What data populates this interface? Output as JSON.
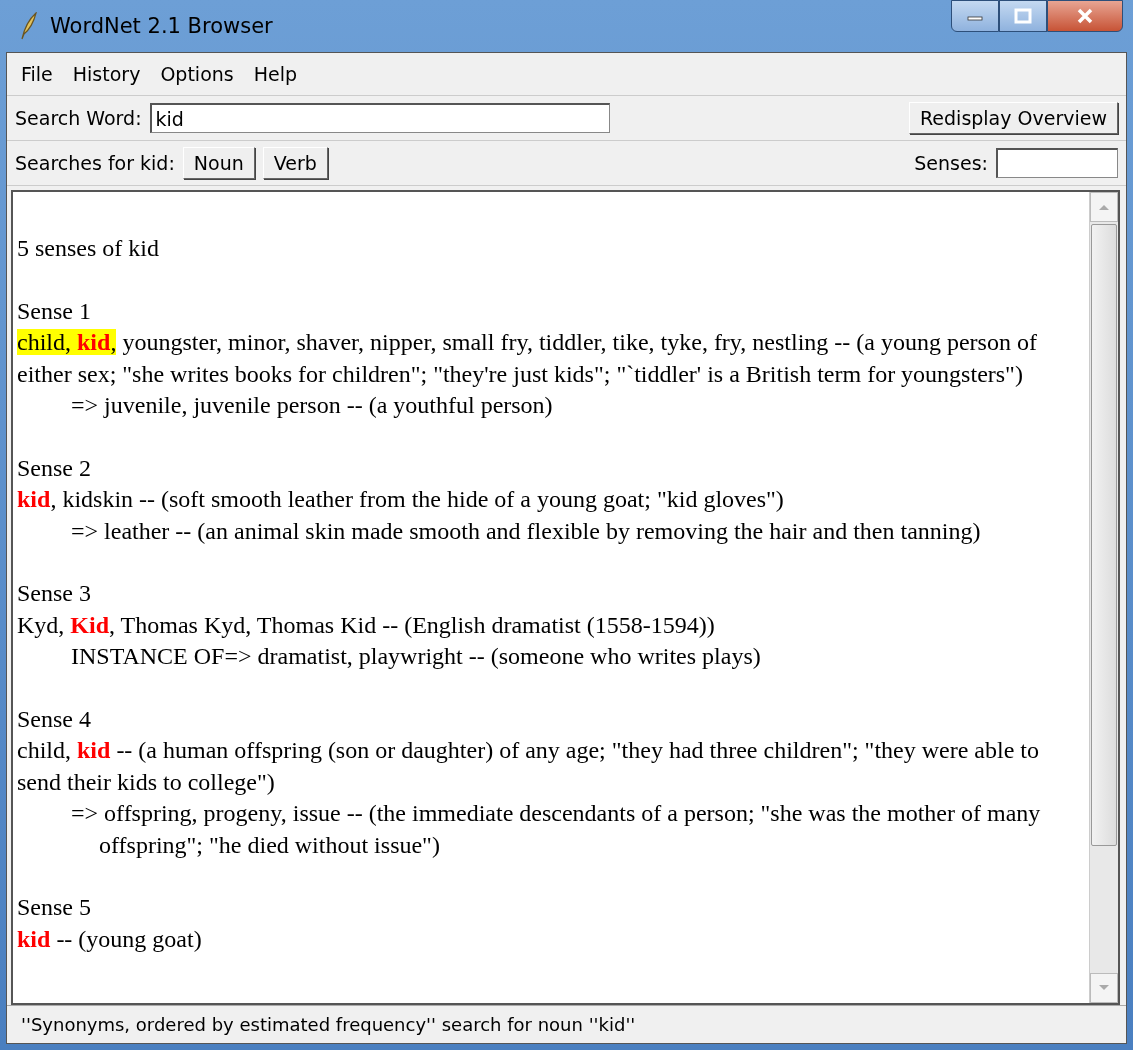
{
  "window": {
    "title": "WordNet 2.1 Browser"
  },
  "menu": [
    "File",
    "History",
    "Options",
    "Help"
  ],
  "search": {
    "label": "Search Word:",
    "value": "kid",
    "button": "Redisplay Overview"
  },
  "searches": {
    "label": "Searches for kid:",
    "buttons": [
      "Noun",
      "Verb"
    ],
    "senses_label": "Senses:"
  },
  "results": {
    "summary": "5 senses of kid",
    "senses": [
      {
        "heading": "Sense 1",
        "selected": true,
        "head": "child, **kid**,",
        "body": "youngster, minor, shaver, nipper, small fry, tiddler, tike, tyke, fry, nestling -- (a young person of either sex; \"she writes books for children\"; \"they're just kids\"; \"`tiddler' is a British term for youngsters\")",
        "pointers": [
          "=> juvenile, juvenile person -- (a youthful person)"
        ]
      },
      {
        "heading": "Sense 2",
        "selected": false,
        "head": "**kid**,",
        "body": "kidskin -- (soft smooth leather from the hide of a young goat; \"kid gloves\")",
        "pointers": [
          "=> leather -- (an animal skin made smooth and flexible by removing the hair and then tanning)"
        ]
      },
      {
        "heading": "Sense 3",
        "selected": false,
        "head": "Kyd, **Kid**,",
        "body": "Thomas Kyd, Thomas Kid -- (English dramatist (1558-1594))",
        "pointers": [
          "INSTANCE OF=> dramatist, playwright -- (someone who writes plays)"
        ]
      },
      {
        "heading": "Sense 4",
        "selected": false,
        "head": "child, **kid**",
        "body": "-- (a human offspring (son or daughter) of any age; \"they had three children\"; \"they were able to send their kids to college\")",
        "pointers": [
          "=> offspring, progeny, issue -- (the immediate descendants of a person; \"she was the mother of many offspring\"; \"he died without issue\")"
        ]
      },
      {
        "heading": "Sense 5",
        "selected": false,
        "head": "**kid**",
        "body": "-- (young goat)"
      }
    ]
  },
  "status_bar": "''Synonyms, ordered by estimated frequency'' search for noun ''kid''"
}
